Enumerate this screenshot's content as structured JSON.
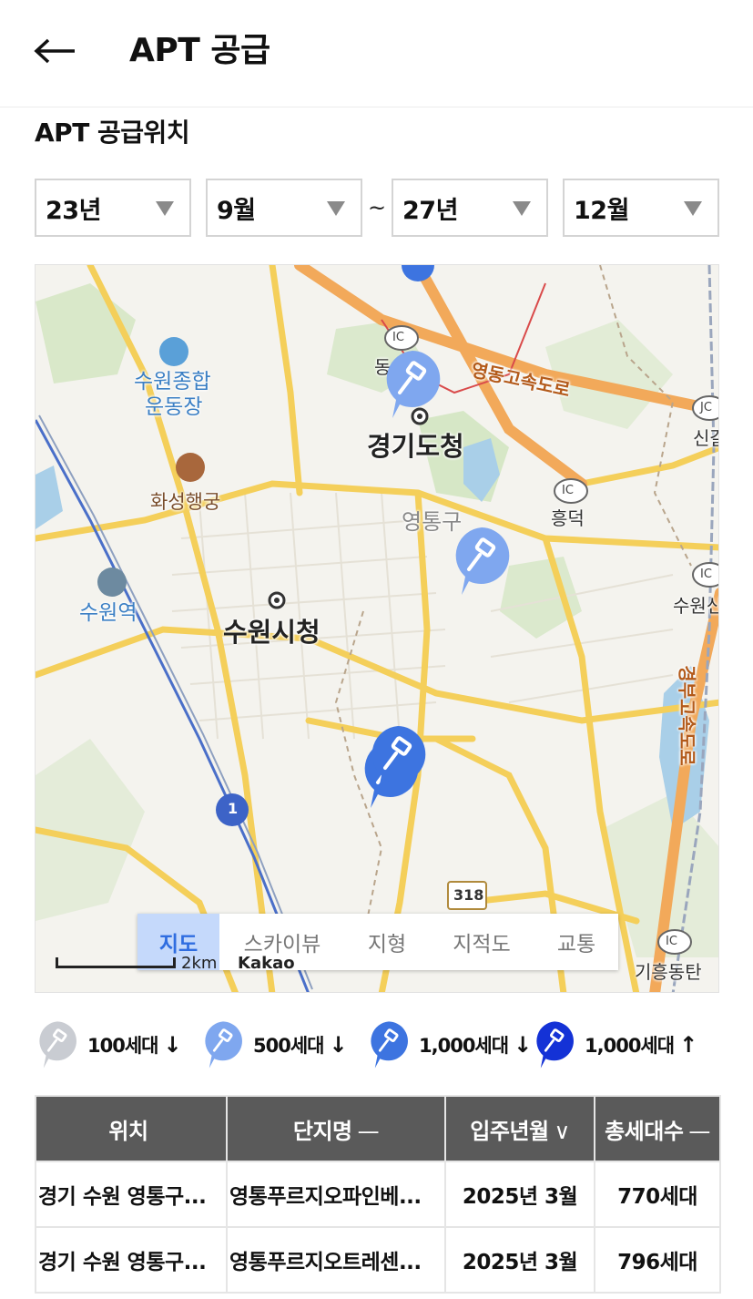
{
  "header": {
    "title": "APT 공급",
    "back_icon": "arrow-left-icon"
  },
  "section": {
    "title": "APT 공급위치"
  },
  "filters": {
    "start_year": "23년",
    "start_month": "9월",
    "separator": "~",
    "end_year": "27년",
    "end_month": "12월"
  },
  "map": {
    "labels": {
      "gyeonggi_dochung": "경기도청",
      "suwon_sicheong": "수원시청",
      "yeongtong_gu": "영통구",
      "suwon_sports_1": "수원종합",
      "suwon_sports_2": "운동장",
      "hwaseong": "화성행궁",
      "suwon_station": "수원역",
      "yeongdong_expressway": "영동고속도로",
      "gyeongbu_expressway": "경부고속도로",
      "heungdeok": "흥덕",
      "singal": "신갈",
      "suwon_ic": "수원신",
      "giheung": "기흥동탄",
      "dong": "동",
      "ic": "IC",
      "jc": "JC",
      "route_1": "1",
      "route_318": "318",
      "scale": "2km",
      "provider": "Kakao"
    },
    "map_types": [
      "지도",
      "스카이뷰",
      "지형",
      "지적도",
      "교통"
    ],
    "active_map_type": "지도"
  },
  "legend": [
    {
      "label": "100세대",
      "arrow": "↓",
      "color": "#c9ccd2"
    },
    {
      "label": "500세대",
      "arrow": "↓",
      "color": "#7fa7ef"
    },
    {
      "label": "1,000세대",
      "arrow": "↓",
      "color": "#3d74e0"
    },
    {
      "label": "1,000세대",
      "arrow": "↑",
      "color": "#1432d6"
    }
  ],
  "table": {
    "headers": [
      {
        "label": "위치",
        "sort": ""
      },
      {
        "label": "단지명",
        "sort": "—"
      },
      {
        "label": "입주년월",
        "sort": "∨"
      },
      {
        "label": "총세대수",
        "sort": "—"
      }
    ],
    "rows": [
      {
        "location": "경기 수원 영통구...",
        "complex": "영통푸르지오파인베...",
        "move_in": "2025년 3월",
        "units": "770세대"
      },
      {
        "location": "경기 수원 영통구...",
        "complex": "영통푸르지오트레센...",
        "move_in": "2025년 3월",
        "units": "796세대"
      }
    ]
  },
  "colors": {
    "header_bg": "#5a5a5a",
    "accent": "#2f6de0",
    "marker_500": "#7fa7ef",
    "marker_1000": "#3d74e0"
  }
}
